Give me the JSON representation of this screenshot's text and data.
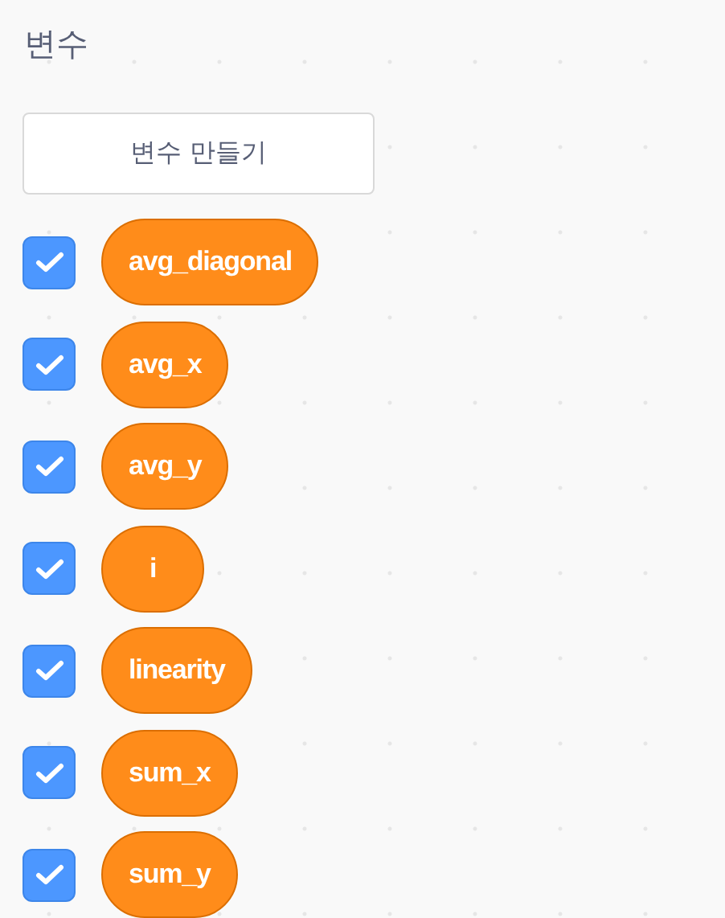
{
  "category": {
    "title": "변수"
  },
  "make_button": {
    "label": "변수 만들기"
  },
  "variables": [
    {
      "name": "avg_diagonal",
      "checked": true
    },
    {
      "name": "avg_x",
      "checked": true
    },
    {
      "name": "avg_y",
      "checked": true
    },
    {
      "name": "i",
      "checked": true
    },
    {
      "name": "linearity",
      "checked": true
    },
    {
      "name": "sum_x",
      "checked": true
    },
    {
      "name": "sum_y",
      "checked": true
    }
  ]
}
